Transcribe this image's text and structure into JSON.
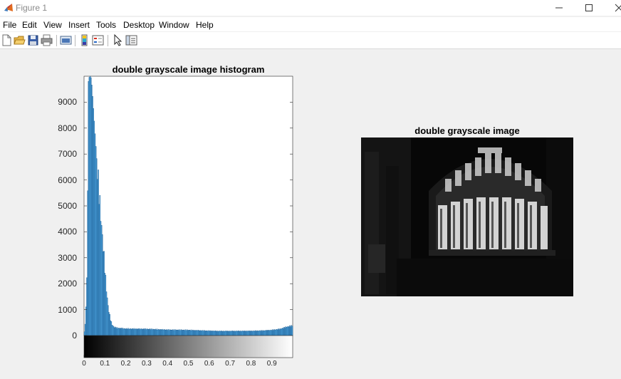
{
  "window": {
    "title": "Figure 1",
    "controls": [
      "minimize-icon",
      "maximize-icon",
      "close-icon"
    ]
  },
  "menu": {
    "items": [
      "File",
      "Edit",
      "View",
      "Insert",
      "Tools",
      "Desktop",
      "Window",
      "Help"
    ]
  },
  "toolbar": {
    "icons": [
      "new-figure-icon",
      "open-file-icon",
      "save-icon",
      "print-icon",
      "link-plot-icon",
      "colorbar-icon",
      "legend-icon",
      "edit-plot-arrow-icon",
      "property-inspector-icon"
    ]
  },
  "histogram_axes": {
    "title": "double grayscale image histogram"
  },
  "image_axes": {
    "title": "double grayscale image"
  },
  "chart_data": {
    "type": "bar",
    "title": "double grayscale image histogram",
    "xlabel": "",
    "ylabel": "",
    "xlim": [
      0,
      1
    ],
    "ylim": [
      0,
      10000
    ],
    "yticks": [
      0,
      1000,
      2000,
      3000,
      4000,
      5000,
      6000,
      7000,
      8000,
      9000
    ],
    "xticks": [
      0,
      0.1,
      0.2,
      0.3,
      0.4,
      0.5,
      0.6,
      0.7,
      0.8,
      0.9
    ],
    "bar_color": "#0072bd",
    "colorbar": "gray",
    "bins": 256,
    "profile_x": [
      0,
      0.008,
      0.016,
      0.02,
      0.023,
      0.027,
      0.031,
      0.035,
      0.043,
      0.051,
      0.059,
      0.067,
      0.074,
      0.082,
      0.09,
      0.098,
      0.106,
      0.114,
      0.122,
      0.13,
      0.137,
      0.145,
      0.16,
      0.18,
      0.2,
      0.3,
      0.4,
      0.5,
      0.6,
      0.65,
      0.7,
      0.8,
      0.85,
      0.9,
      0.94,
      0.97,
      1.0
    ],
    "profile_y": [
      0,
      600,
      2900,
      9700,
      9900,
      10000,
      10000,
      9900,
      9000,
      8000,
      7000,
      6100,
      5300,
      4400,
      3600,
      2800,
      1900,
      1200,
      800,
      520,
      380,
      320,
      290,
      275,
      260,
      250,
      220,
      210,
      180,
      170,
      170,
      175,
      185,
      210,
      250,
      330,
      380
    ]
  }
}
